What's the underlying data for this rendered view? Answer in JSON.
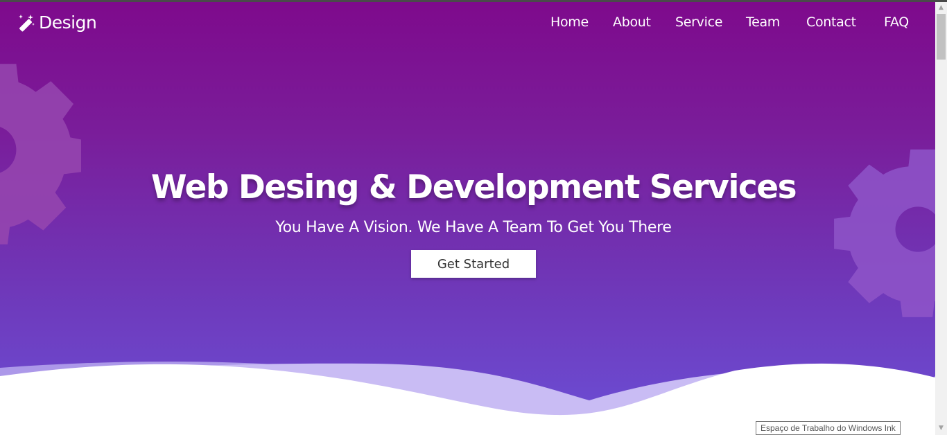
{
  "brand": {
    "name": "Design",
    "icon": "magic-wand-icon"
  },
  "nav": {
    "items": [
      "Home",
      "About",
      "Service",
      "Team",
      "Contact",
      "FAQ"
    ]
  },
  "hero": {
    "headline": "Web Desing & Development Services",
    "subline": "You Have A Vision. We Have A Team To Get You There",
    "cta_label": "Get Started"
  },
  "colors": {
    "gradient_top": "#7e0a8c",
    "gradient_bottom": "#6b4fd6",
    "wave_light": "#c4b5f2",
    "accent_white": "#ffffff"
  },
  "tooltip": {
    "text": "Espaço de Trabalho do Windows Ink"
  }
}
